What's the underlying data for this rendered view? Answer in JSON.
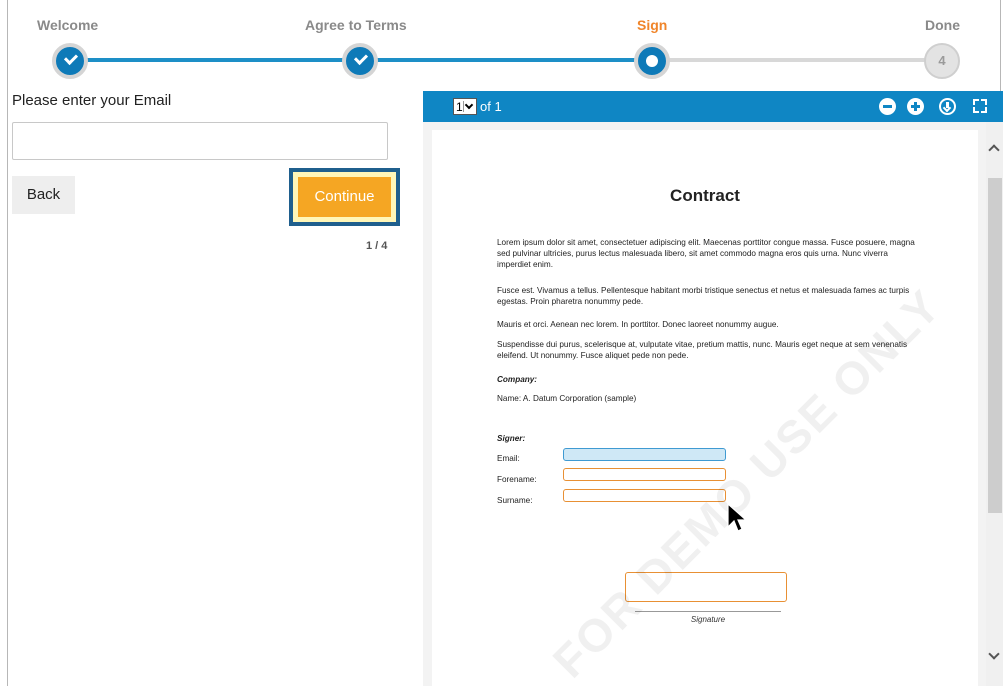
{
  "stepper": {
    "steps": [
      {
        "label": "Welcome",
        "state": "done"
      },
      {
        "label": "Agree to Terms",
        "state": "done"
      },
      {
        "label": "Sign",
        "state": "current"
      },
      {
        "label": "Done",
        "state": "todo",
        "number": "4"
      }
    ]
  },
  "form": {
    "email_label": "Please enter your Email",
    "email_value": "",
    "back_label": "Back",
    "continue_label": "Continue",
    "page_indicator": "1 / 4"
  },
  "viewer": {
    "page_value": "1",
    "of_text": "of 1"
  },
  "document": {
    "title": "Contract",
    "paragraphs": [
      "Lorem ipsum dolor sit amet, consectetuer adipiscing elit. Maecenas porttitor congue massa. Fusce posuere, magna sed pulvinar ultricies, purus lectus malesuada libero, sit amet commodo magna eros quis urna. Nunc viverra imperdiet enim.",
      "Fusce est. Vivamus a tellus. Pellentesque habitant morbi tristique senectus et netus et malesuada fames ac turpis egestas. Proin pharetra nonummy pede.",
      "Mauris et orci. Aenean nec lorem. In porttitor. Donec laoreet nonummy augue.",
      "Suspendisse dui purus, scelerisque at, vulputate vitae, pretium mattis, nunc. Mauris eget neque at sem venenatis eleifend. Ut nonummy. Fusce aliquet pede non pede."
    ],
    "company_heading": "Company:",
    "company_name": "Name: A. Datum Corporation (sample)",
    "signer_heading": "Signer:",
    "email_field_label": "Email:",
    "forename_field_label": "Forename:",
    "surname_field_label": "Surname:",
    "signature_caption": "Signature",
    "watermark": "FOR DEMO USE ONLY"
  },
  "colors": {
    "accent_blue": "#0f86c4",
    "active_step": "#f0852a",
    "continue_button": "#f5a623"
  }
}
